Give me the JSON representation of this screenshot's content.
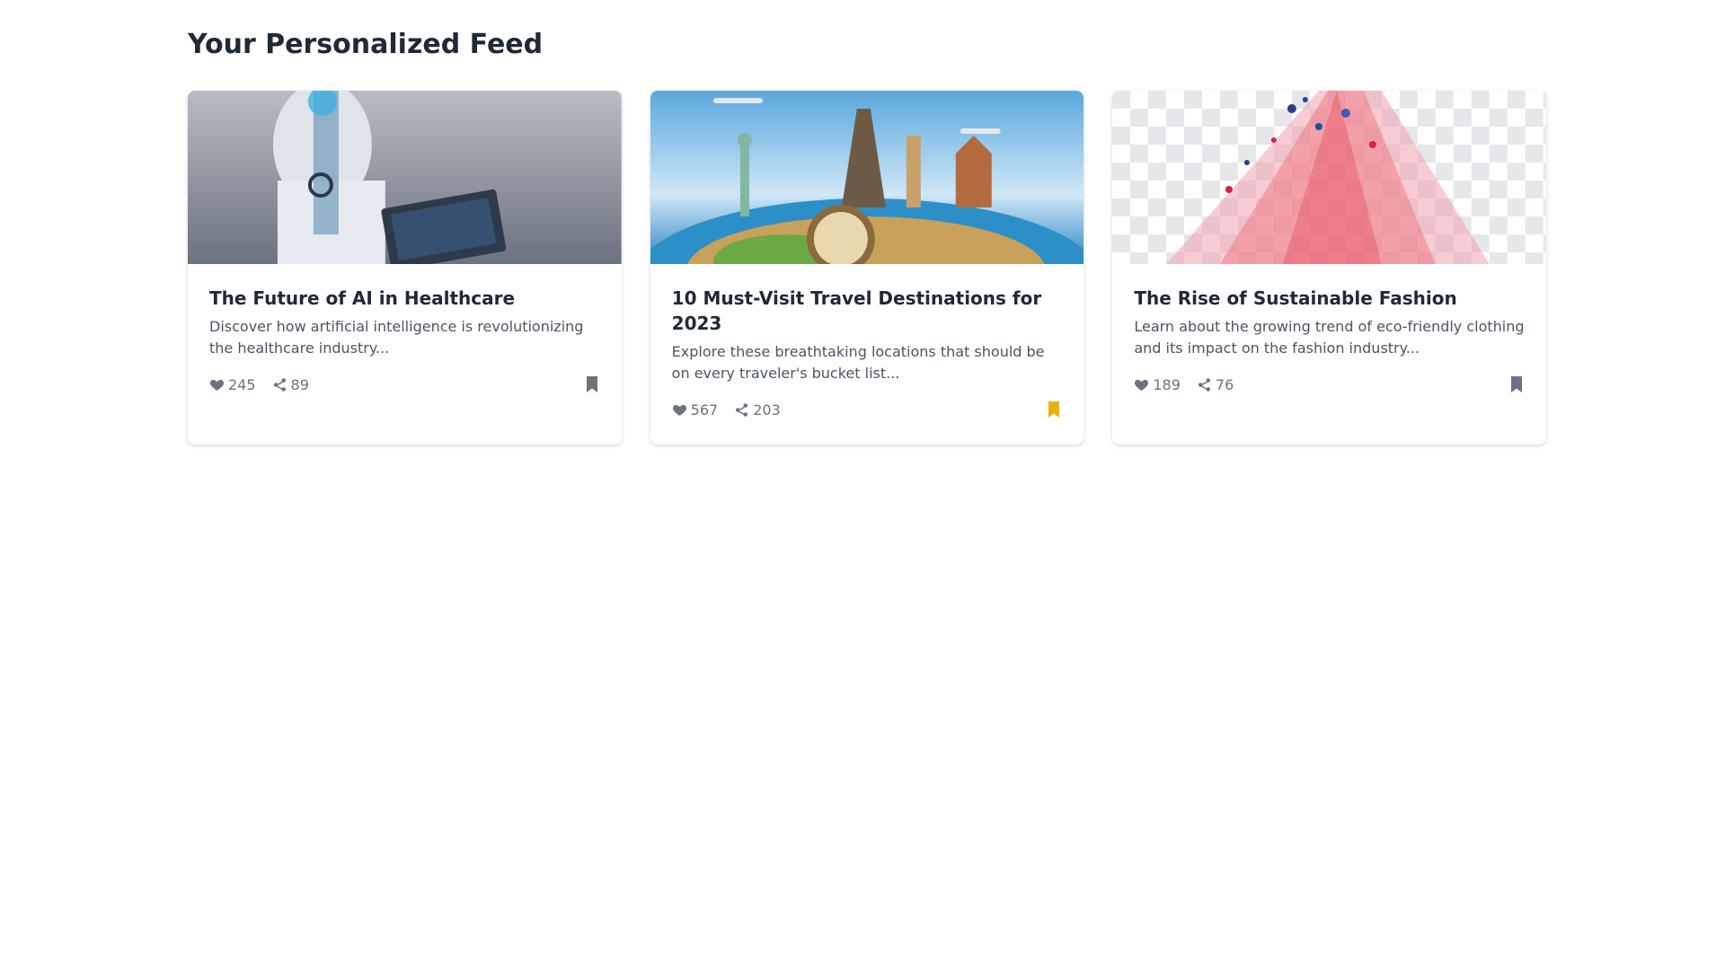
{
  "page": {
    "title": "Your Personalized Feed"
  },
  "colors": {
    "bookmark_default": "#6b7280",
    "bookmark_active": "#eab308"
  },
  "cards": [
    {
      "title": "The Future of AI in Healthcare",
      "description": "Discover how artificial intelligence is revolutionizing the healthcare industry...",
      "likes": "245",
      "shares": "89",
      "bookmarked": false,
      "image_icon": "ai-doctor-image"
    },
    {
      "title": "10 Must-Visit Travel Destinations for 2023",
      "description": "Explore these breathtaking locations that should be on every traveler's bucket list...",
      "likes": "567",
      "shares": "203",
      "bookmarked": true,
      "image_icon": "world-landmarks-image"
    },
    {
      "title": "The Rise of Sustainable Fashion",
      "description": "Learn about the growing trend of eco-friendly clothing and its impact on the fashion industry...",
      "likes": "189",
      "shares": "76",
      "bookmarked": false,
      "image_icon": "fabric-splash-image"
    }
  ]
}
